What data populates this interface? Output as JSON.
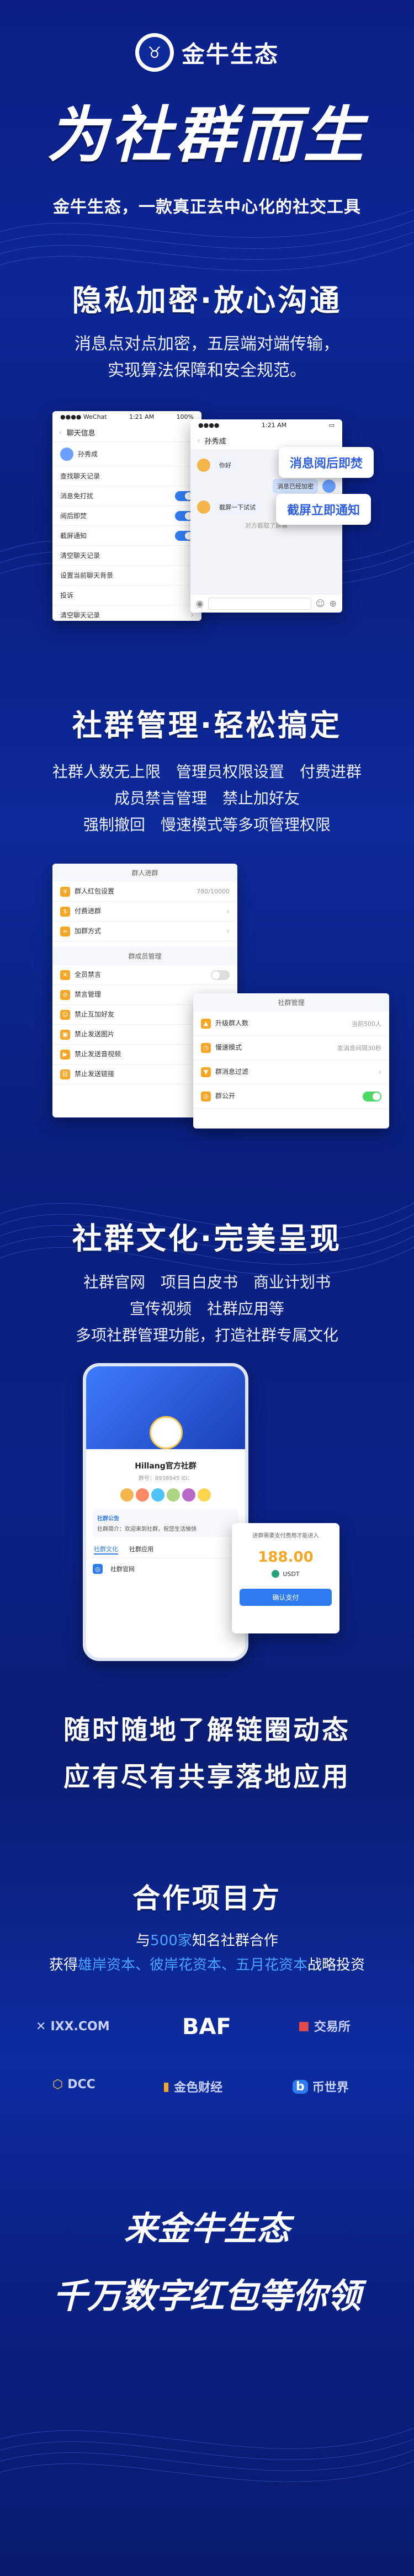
{
  "brand": {
    "logo_glyph": "♉",
    "name": "金牛生态"
  },
  "hero": {
    "title": "为社群而生",
    "subtitle": "金牛生态，一款真正去中心化的社交工具"
  },
  "section1": {
    "title": "隐私加密·放心沟通",
    "lines": [
      "消息点对点加密，五层端对端传输，",
      "实现算法保障和安全规范。"
    ],
    "bubble_read_burn": "消息阅后即焚",
    "bubble_screenshot": "截屏立即通知",
    "phone_left": {
      "status_left": "●●●● WeChat",
      "status_time": "1:21 AM",
      "status_right": "100%",
      "nav_title": "聊天信息",
      "user_name": "孙秀成",
      "rows": [
        "查找聊天记录",
        "消息免打扰",
        "阅后即焚",
        "截屏通知",
        "清空聊天记录",
        "设置当前聊天背景",
        "投诉",
        "清空聊天记录"
      ]
    },
    "phone_right": {
      "status_time": "1:21 AM",
      "nav_title": "孙秀成",
      "messages": [
        "你好",
        "消息已经加密",
        "截屏一下试试",
        "对方截取了屏幕"
      ]
    }
  },
  "section2": {
    "title": "社群管理·轻松搞定",
    "lines": [
      "社群人数无上限　管理员权限设置　付费进群",
      "成员禁言管理　禁止加好友",
      "强制撤回　慢速模式等多项管理权限"
    ],
    "card_left": {
      "head1": "群人进群",
      "rows1": [
        {
          "label": "群人红包设置",
          "value": "780/10000"
        },
        {
          "label": "付费进群",
          "value": ""
        },
        {
          "label": "加群方式",
          "value": ""
        }
      ],
      "head2": "群成员管理",
      "rows2": [
        "全员禁言",
        "禁言管理",
        "禁止互加好友",
        "禁止发送图片",
        "禁止发送音视频",
        "禁止发送链接"
      ]
    },
    "card_right": {
      "head": "社群管理",
      "rows": [
        {
          "label": "升级群人数",
          "value": "当前500人"
        },
        {
          "label": "慢速模式",
          "value": "发消息间隔30秒"
        },
        {
          "label": "群消息过滤",
          "value": ""
        },
        {
          "label": "群公开",
          "value": ""
        }
      ]
    }
  },
  "section3": {
    "title": "社群文化·完美呈现",
    "lines": [
      "社群官网　项目白皮书　商业计划书",
      "宣传视频　社群应用等",
      "多项社群管理功能，打造社群专属文化"
    ],
    "phone": {
      "group_name": "Hillang官方社群",
      "group_id": "群号：8938945 ID：",
      "tabs": [
        "社群文化",
        "社群应用"
      ],
      "tag": "社群公告",
      "notice": "社群简介：欢迎来到社群，祝您生活愉快",
      "tag2": "社群官网"
    },
    "pay_card": {
      "title": "进群需要支付费用才能进入",
      "amount": "188.00",
      "coin": "USDT",
      "button": "确认支付"
    }
  },
  "section4": {
    "line1": "随时随地了解链圈动态",
    "line2": "应有尽有共享落地应用"
  },
  "partners": {
    "title": "合作项目方",
    "line1_prefix": "与",
    "line1_highlight": "500家",
    "line1_suffix": "知名社群合作",
    "line2_prefix": "获得",
    "line2_highlight": "雄岸资本、彼岸花资本、五月花资本",
    "line2_suffix": "战略投资",
    "logos": [
      "IXX.COM",
      "BAF",
      "交易所",
      "DCC",
      "金色财经",
      "币世界"
    ]
  },
  "footer": {
    "line1": "来金牛生态",
    "line2": "千万数字红包等你领"
  },
  "colors": {
    "accent": "#2f7bf2",
    "highlight": "#4aa3ff",
    "bg": "#0b1f86"
  }
}
